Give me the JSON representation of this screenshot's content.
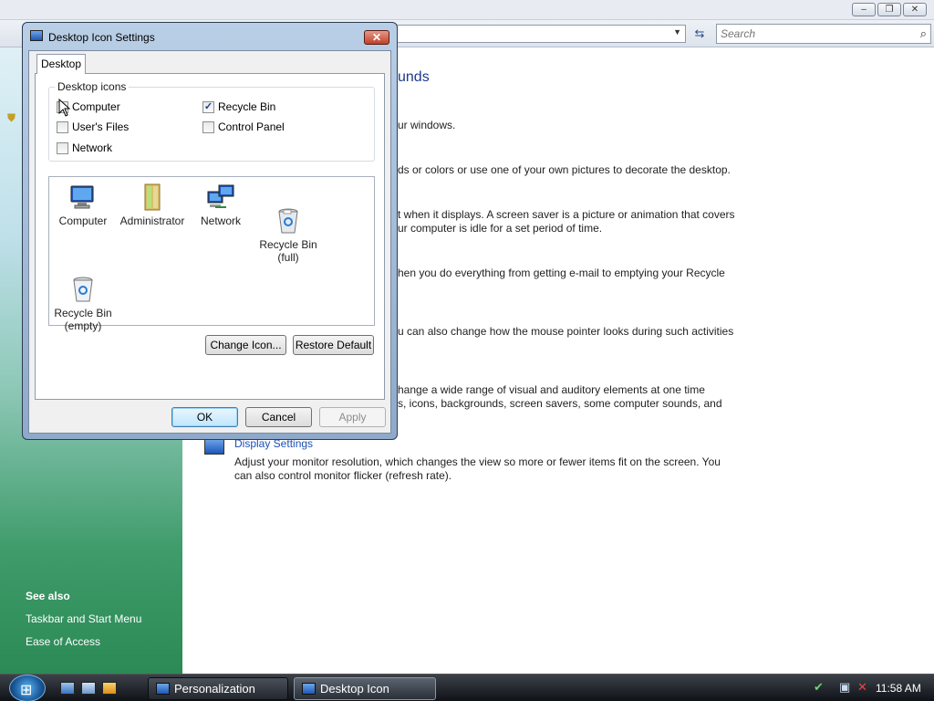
{
  "window": {
    "search_placeholder": "Search",
    "caption_buttons": [
      "minimize",
      "maximize",
      "close"
    ],
    "main_title": "unds",
    "content_lines": [
      "ur windows.",
      "ds or colors or use one of your own pictures to decorate the desktop.",
      "t when it displays. A screen saver is a picture or animation that covers",
      "ur computer is idle for a set period of time.",
      "hen you do everything from getting e-mail to emptying your Recycle",
      "u can also change how the mouse pointer looks during such activities",
      "hange a wide range of visual and auditory elements at one time",
      "s, icons, backgrounds, screen savers, some computer sounds, and"
    ],
    "display_settings": {
      "link": "Display Settings",
      "desc_1": "Adjust your monitor resolution, which changes the view so more or fewer items fit on the screen. You",
      "desc_2": "can also control monitor flicker (refresh rate)."
    },
    "see_also": {
      "title": "See also",
      "items": [
        "Taskbar and Start Menu",
        "Ease of Access"
      ]
    }
  },
  "dialog": {
    "title": "Desktop Icon Settings",
    "tab": "Desktop",
    "group_label": "Desktop icons",
    "checkboxes": [
      {
        "label": "Computer",
        "checked": false
      },
      {
        "label": "Recycle Bin",
        "checked": true
      },
      {
        "label": "User's Files",
        "checked": false
      },
      {
        "label": "Control Panel",
        "checked": false
      },
      {
        "label": "Network",
        "checked": false
      }
    ],
    "icons": [
      {
        "label": "Computer",
        "icon": "computer-icon"
      },
      {
        "label": "Administrator",
        "icon": "user-folder-icon"
      },
      {
        "label": "Network",
        "icon": "network-icon"
      },
      {
        "label": "Recycle Bin\n(full)",
        "icon": "recycle-bin-full-icon"
      },
      {
        "label": "Recycle Bin\n(empty)",
        "icon": "recycle-bin-empty-icon"
      }
    ],
    "change_icon": "Change Icon...",
    "restore_default": "Restore Default",
    "ok": "OK",
    "cancel": "Cancel",
    "apply": "Apply"
  },
  "taskbar": {
    "items": [
      "Personalization",
      "Desktop Icon Settings"
    ],
    "clock": "11:58 AM"
  }
}
